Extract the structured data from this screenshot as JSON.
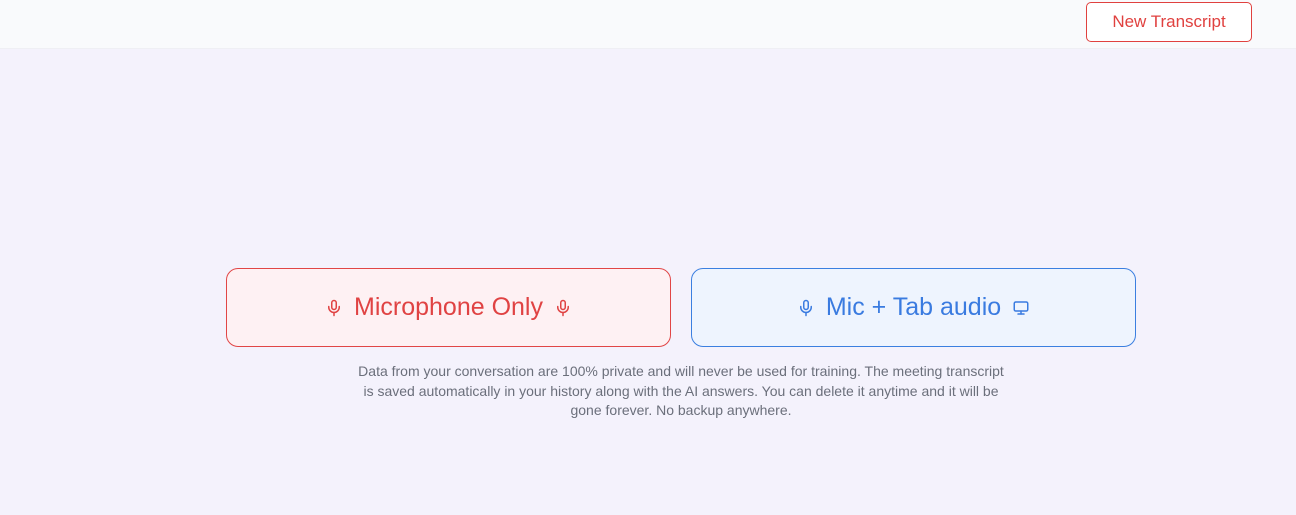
{
  "header": {
    "new_transcript_label": "New Transcript"
  },
  "modes": {
    "microphone_only": {
      "label": "Microphone Only",
      "icons": [
        "microphone-icon",
        "microphone-icon"
      ],
      "accent": "#e04343",
      "background": "#fef1f3"
    },
    "mic_tab_audio": {
      "label": "Mic + Tab audio",
      "icons": [
        "microphone-icon",
        "monitor-icon"
      ],
      "accent": "#3a7be0",
      "background": "#eef4fe"
    }
  },
  "notice": {
    "text": "Data from your conversation are 100% private and will never be used for training. The meeting transcript is saved automatically in your history along with the AI answers. You can delete it anytime and it will be gone forever. No backup anywhere."
  },
  "colors": {
    "page_background": "#f4f2fc",
    "header_background": "#f9fafc",
    "text_muted": "#6b6f7b"
  }
}
